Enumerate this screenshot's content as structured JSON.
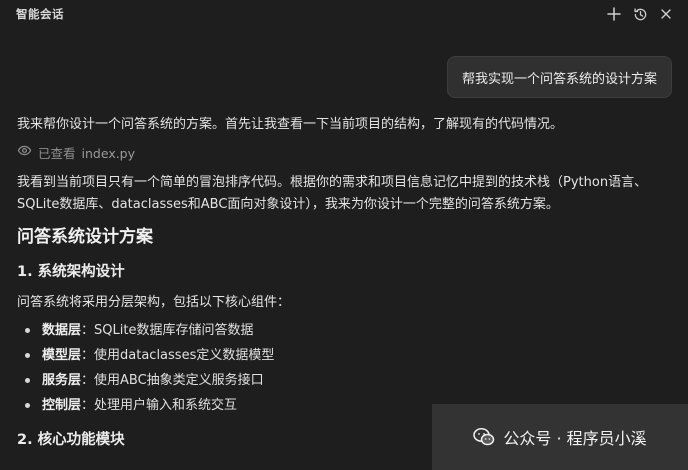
{
  "header": {
    "title": "智能会话",
    "icons": [
      "plus-icon",
      "history-icon",
      "close-icon"
    ]
  },
  "user_message": "帮我实现一个问答系统的设计方案",
  "assistant": {
    "intro": "我来帮你设计一个问答系统的方案。首先让我查看一下当前项目的结构，了解现有的代码情况。",
    "viewed_label": "已查看",
    "viewed_file": "index.py",
    "body": "我看到当前项目只有一个简单的冒泡排序代码。根据你的需求和项目信息记忆中提到的技术栈（Python语言、SQLite数据库、dataclasses和ABC面向对象设计），我来为你设计一个完整的问答系统方案。",
    "heading": "问答系统设计方案",
    "section1_title": "1. 系统架构设计",
    "architecture_intro": "问答系统将采用分层架构，包括以下核心组件：",
    "components": [
      {
        "name": "数据层",
        "desc": "：SQLite数据库存储问答数据"
      },
      {
        "name": "模型层",
        "desc": "：使用dataclasses定义数据模型"
      },
      {
        "name": "服务层",
        "desc": "：使用ABC抽象类定义服务接口"
      },
      {
        "name": "控制层",
        "desc": "：处理用户输入和系统交互"
      }
    ],
    "section2_title": "2. 核心功能模块"
  },
  "watermark": {
    "text": "公众号 · 程序员小溪"
  },
  "colors": {
    "background": "#1e1e1e",
    "bubble": "#303030",
    "text": "#e4e4e4",
    "muted": "#8e8e8e"
  }
}
